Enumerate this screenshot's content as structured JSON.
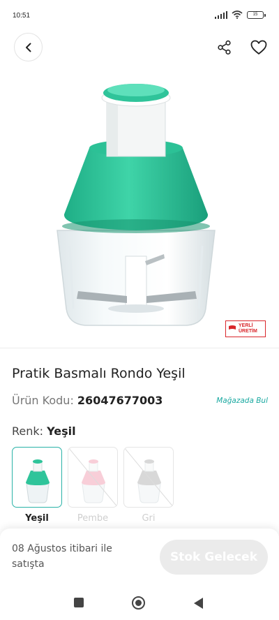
{
  "status_bar": {
    "time": "10:51",
    "battery": "15"
  },
  "header": {
    "back_icon": "chevron-left-icon",
    "share_icon": "share-icon",
    "favorite_icon": "heart-outline-icon"
  },
  "product": {
    "image_icon": "food-chopper-image",
    "badge_line1": "YERLİ",
    "badge_line2": "ÜRETİM",
    "title": "Pratik Basmalı Rondo Yeşil",
    "code_label": "Ürün Kodu:",
    "code_value": "26047677003",
    "store_link": "Mağazada Bul",
    "color_label": "Renk:",
    "color_value": "Yeşil"
  },
  "variants": [
    {
      "label": "Yeşil",
      "color": "#2fc49a",
      "selected": true,
      "available": true
    },
    {
      "label": "Pembe",
      "color": "#f2a7b9",
      "selected": false,
      "available": false
    },
    {
      "label": "Gri",
      "color": "#b9b9b9",
      "selected": false,
      "available": false
    }
  ],
  "bottom_bar": {
    "availability_text": "08 Ağustos itibari ile satışta",
    "button_label": "Stok Gelecek"
  },
  "colors": {
    "accent": "#29b2a7",
    "product_green": "#2fc49a",
    "badge_red": "#d9262b"
  }
}
